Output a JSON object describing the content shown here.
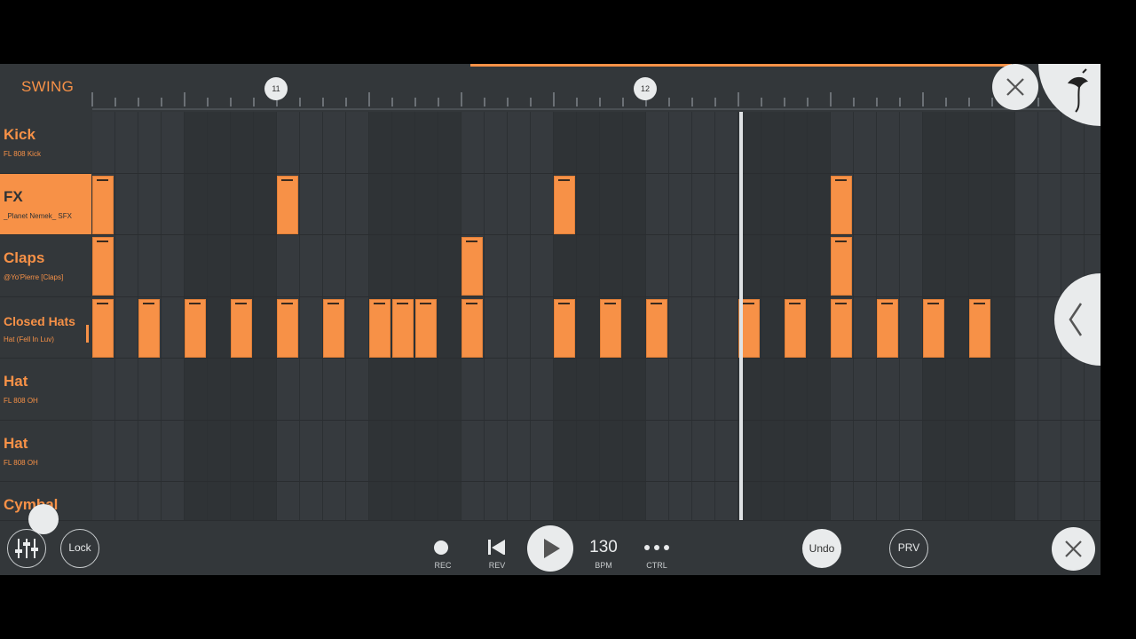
{
  "header": {
    "swing_label": "SWING",
    "bar_markers": [
      "11",
      "12"
    ]
  },
  "channels": [
    {
      "name": "Kick",
      "sample": "FL 808 Kick",
      "selected": false,
      "steps": []
    },
    {
      "name": "FX",
      "sample": "_Planet Nemek_ SFX",
      "selected": true,
      "steps": [
        0,
        8,
        20,
        32
      ]
    },
    {
      "name": "Claps",
      "sample": "@Yo'Pierre [Claps]",
      "selected": false,
      "steps": [
        0,
        16,
        32
      ]
    },
    {
      "name": "Closed Hats",
      "sample": "Hat (Fell In Luv)",
      "selected": false,
      "steps": [
        0,
        2,
        4,
        6,
        8,
        10,
        12,
        13,
        14,
        16,
        20,
        22,
        24,
        28,
        30,
        32,
        34,
        36,
        38
      ]
    },
    {
      "name": "Hat",
      "sample": "FL 808 OH",
      "selected": false,
      "steps": []
    },
    {
      "name": "Hat",
      "sample": "FL 808 OH",
      "selected": false,
      "steps": []
    },
    {
      "name": "Cymbal",
      "sample": "",
      "selected": false,
      "steps": []
    }
  ],
  "transport": {
    "lock_label": "Lock",
    "rec_label": "REC",
    "rev_label": "REV",
    "bpm_value": "130",
    "bpm_label": "BPM",
    "ctrl_label": "CTRL",
    "undo_label": "Undo",
    "prv_label": "PRV"
  },
  "colors": {
    "accent": "#f79147",
    "background": "#323639",
    "button_light": "#e9ebec"
  },
  "icons": {
    "mixer": "mixer-icon",
    "record": "record-icon",
    "rewind": "skip-back-icon",
    "play": "play-icon",
    "more": "more-dots-icon",
    "close": "close-icon",
    "logo": "fl-fruit-logo-icon",
    "back": "chevron-left-icon"
  }
}
